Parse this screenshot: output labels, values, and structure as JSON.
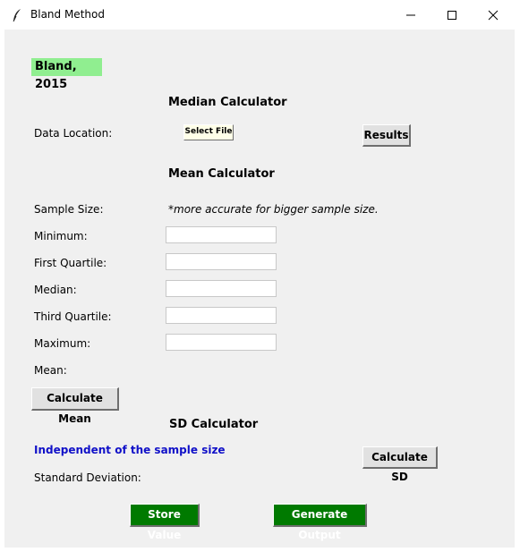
{
  "window": {
    "title": "Bland Method",
    "icon": "feather-icon",
    "controls": [
      "minimize-icon",
      "maximize-icon",
      "close-icon"
    ]
  },
  "badge": {
    "text": "Bland, 2015",
    "color": "#90ee90"
  },
  "median": {
    "title": "Median Calculator",
    "data_location_label": "Data Location:",
    "select_file_label": "Select File",
    "results_label": "Results"
  },
  "mean": {
    "title": "Mean Calculator",
    "sample_size_label": "Sample Size:",
    "note": "*more accurate for bigger sample size.",
    "fields": [
      {
        "label": "Minimum:",
        "value": ""
      },
      {
        "label": "First Quartile:",
        "value": ""
      },
      {
        "label": "Median:",
        "value": ""
      },
      {
        "label": "Third Quartile:",
        "value": ""
      },
      {
        "label": "Maximum:",
        "value": ""
      }
    ],
    "mean_label": "Mean:",
    "calculate_label": "Calculate Mean"
  },
  "sd": {
    "title": "SD Calculator",
    "note": "Independent of the sample size",
    "note_color": "#1010c8",
    "calculate_label": "Calculate SD",
    "result_label": "Standard Deviation:"
  },
  "footer": {
    "store_label": "Store Value",
    "generate_label": "Generate Output",
    "button_color": "#007a00"
  }
}
